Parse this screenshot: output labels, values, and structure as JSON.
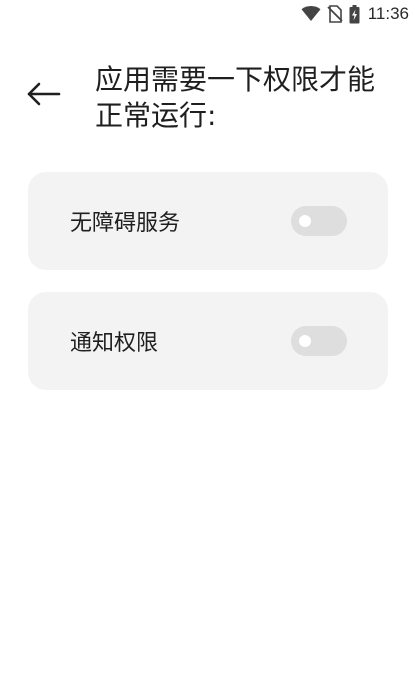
{
  "status_bar": {
    "time": "11:36",
    "icons": [
      "wifi-icon",
      "no-sim-icon",
      "battery-charging-icon"
    ]
  },
  "header": {
    "back_icon": "arrow-left-icon",
    "title": "应用需要一下权限才能正常运行:"
  },
  "permissions": [
    {
      "label": "无障碍服务",
      "enabled": false
    },
    {
      "label": "通知权限",
      "enabled": false
    }
  ],
  "colors": {
    "background": "#ffffff",
    "card": "#f3f3f3",
    "toggle_off_track": "#dedede",
    "toggle_knob": "#ffffff",
    "text": "#1f1f1f"
  }
}
